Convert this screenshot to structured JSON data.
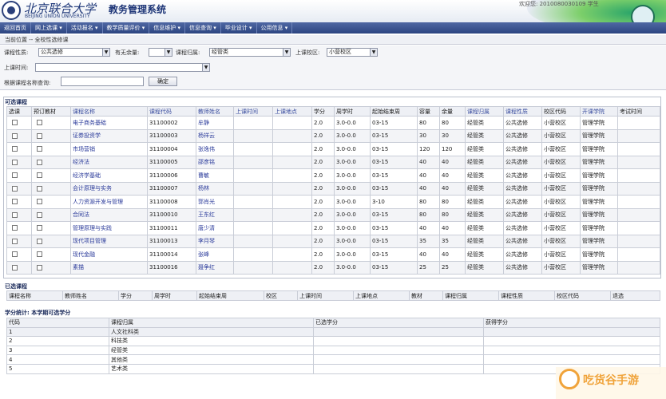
{
  "header": {
    "school_name": "北京联合大学",
    "school_name_en": "BEIJING UNION UNIVERSITY",
    "system_title": "教务管理系统",
    "top_right_text": "欢迎您: 2010080030109 学生"
  },
  "nav": [
    "返回首页",
    "网上选课 ▾",
    "活动报名 ▾",
    "教学质量评价 ▾",
    "信息维护 ▾",
    "信息查询 ▾",
    "毕业设计 ▾",
    "公用信息 ▾"
  ],
  "breadcrumb": "当前位置 -- 全校性选修课",
  "filters": {
    "course_type_label": "课程性质:",
    "course_type_value": "公共选修",
    "has_remaining_label": "有无余量:",
    "has_remaining_value": "",
    "course_category_label": "课程归属:",
    "course_category_value": "经管类",
    "campus_label": "上课校区:",
    "campus_value": "小营校区",
    "time_label": "上课时间:",
    "time_value": "",
    "search_label": "根据课程名称查询:",
    "search_value": "",
    "confirm_button": "确定"
  },
  "available": {
    "title": "可选课程",
    "columns": [
      "选课",
      "预订教材",
      "课程名称",
      "课程代码",
      "教师姓名",
      "上课时间",
      "上课地点",
      "学分",
      "周学时",
      "起始结束周",
      "容量",
      "余量",
      "课程归属",
      "课程性质",
      "校区代码",
      "开课学院",
      "考试时间"
    ],
    "rows": [
      [
        "电子商务基础",
        "31100002",
        "牟静",
        "2.0",
        "3.0-0.0",
        "03-15",
        "80",
        "80",
        "经管类",
        "公共选修",
        "小营校区",
        "管理学院"
      ],
      [
        "证券投资学",
        "31100003",
        "杨祥云",
        "2.0",
        "3.0-0.0",
        "03-15",
        "30",
        "30",
        "经管类",
        "公共选修",
        "小营校区",
        "管理学院"
      ],
      [
        "市场营销",
        "31100004",
        "张逸伟",
        "2.0",
        "3.0-0.0",
        "03-15",
        "120",
        "120",
        "经管类",
        "公共选修",
        "小营校区",
        "管理学院"
      ],
      [
        "经济法",
        "31100005",
        "邵彦铭",
        "2.0",
        "3.0-0.0",
        "03-15",
        "40",
        "40",
        "经管类",
        "公共选修",
        "小营校区",
        "管理学院"
      ],
      [
        "经济学基础",
        "31100006",
        "曹敏",
        "2.0",
        "3.0-0.0",
        "03-15",
        "40",
        "40",
        "经管类",
        "公共选修",
        "小营校区",
        "管理学院"
      ],
      [
        "会计原理与实务",
        "31100007",
        "杨林",
        "2.0",
        "3.0-0.0",
        "03-15",
        "40",
        "40",
        "经管类",
        "公共选修",
        "小营校区",
        "管理学院"
      ],
      [
        "人力资源开发与管理",
        "31100008",
        "郭肖光",
        "2.0",
        "3.0-0.0",
        "3-10",
        "80",
        "80",
        "经管类",
        "公共选修",
        "小营校区",
        "管理学院"
      ],
      [
        "合同法",
        "31100010",
        "王东红",
        "2.0",
        "3.0-0.0",
        "03-15",
        "80",
        "80",
        "经管类",
        "公共选修",
        "小营校区",
        "管理学院"
      ],
      [
        "管理原理与实践",
        "31100011",
        "唐少清",
        "2.0",
        "3.0-0.0",
        "03-15",
        "40",
        "40",
        "经管类",
        "公共选修",
        "小营校区",
        "管理学院"
      ],
      [
        "现代项目管理",
        "31100013",
        "李月琴",
        "2.0",
        "3.0-0.0",
        "03-15",
        "35",
        "35",
        "经管类",
        "公共选修",
        "小营校区",
        "管理学院"
      ],
      [
        "现代金融",
        "31100014",
        "张峰",
        "2.0",
        "3.0-0.0",
        "03-15",
        "40",
        "40",
        "经管类",
        "公共选修",
        "小营校区",
        "管理学院"
      ],
      [
        "素描",
        "31100016",
        "聂争红",
        "2.0",
        "3.0-0.0",
        "03-15",
        "25",
        "25",
        "经管类",
        "公共选修",
        "小营校区",
        "管理学院"
      ]
    ]
  },
  "selected": {
    "title": "已选课程",
    "columns": [
      "课程名称",
      "教师姓名",
      "学分",
      "周学时",
      "起始结束周",
      "校区",
      "上课时间",
      "上课地点",
      "教材",
      "课程归属",
      "课程性质",
      "校区代码",
      "退选"
    ]
  },
  "credits": {
    "title": "学分统计: 本学期可选学分",
    "columns": [
      "代码",
      "课程归属",
      "已选学分",
      "获得学分"
    ],
    "rows": [
      [
        "1",
        "人文社科类",
        "",
        ""
      ],
      [
        "2",
        "科技类",
        "",
        ""
      ],
      [
        "3",
        "经管类",
        "",
        ""
      ],
      [
        "4",
        "其他类",
        "",
        ""
      ],
      [
        "5",
        "艺术类",
        "",
        ""
      ]
    ]
  },
  "watermark": "吃货谷手游"
}
